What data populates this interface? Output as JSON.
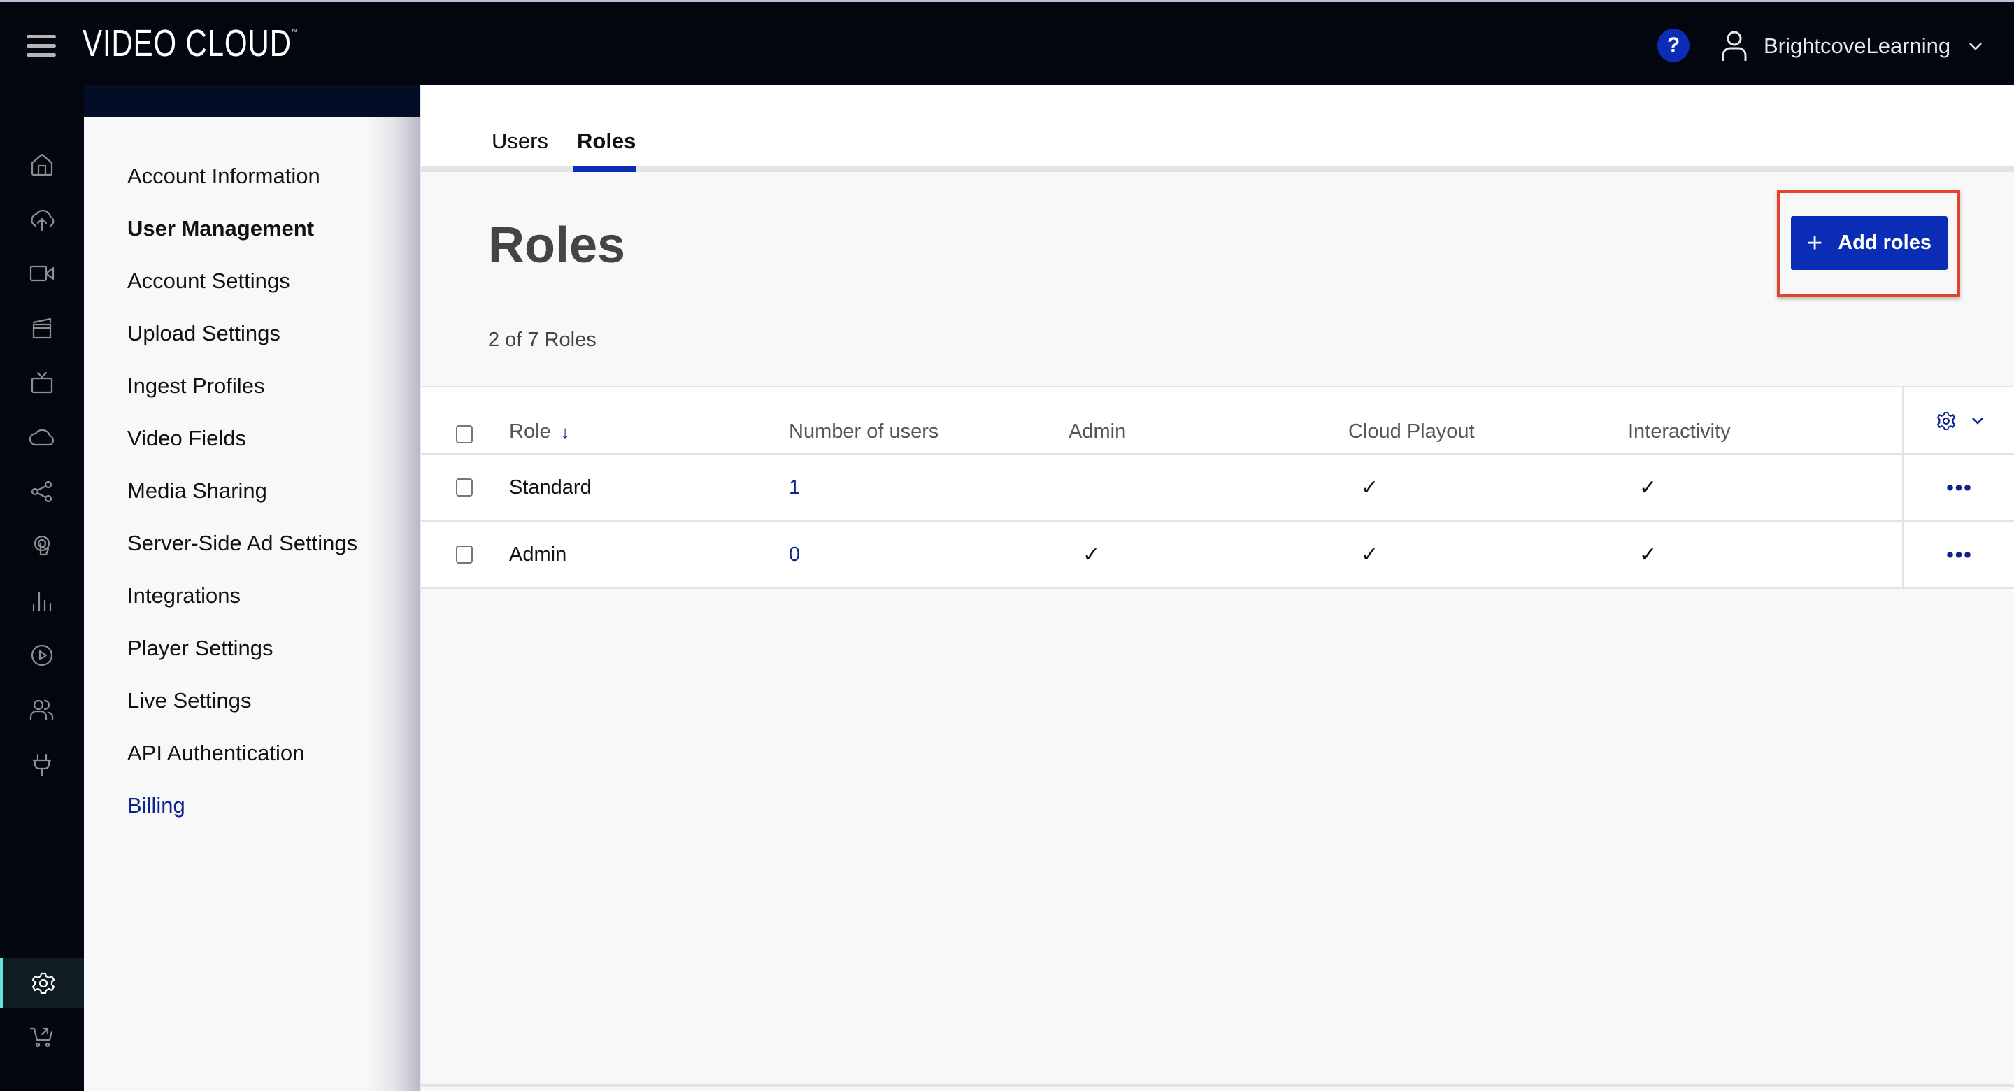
{
  "app": {
    "title": "VIDEO CLOUD",
    "trademark": "™",
    "help_label": "?",
    "account_name": "BrightcoveLearning"
  },
  "rail": {
    "items": [
      {
        "name": "home-icon"
      },
      {
        "name": "upload-icon"
      },
      {
        "name": "video-camera-icon"
      },
      {
        "name": "clapperboard-icon"
      },
      {
        "name": "tv-icon"
      },
      {
        "name": "cloud-icon"
      },
      {
        "name": "share-icon"
      },
      {
        "name": "interactivity-touch-icon"
      },
      {
        "name": "analytics-bars-icon"
      },
      {
        "name": "play-circle-icon"
      },
      {
        "name": "users-icon"
      },
      {
        "name": "plug-icon"
      }
    ],
    "bottom_items": [
      {
        "name": "settings-gear-icon",
        "active": true
      },
      {
        "name": "cart-icon"
      }
    ],
    "active_accent": "#6ee0dc"
  },
  "subnav": {
    "items": [
      {
        "label": "Account Information"
      },
      {
        "label": "User Management",
        "active": true
      },
      {
        "label": "Account Settings"
      },
      {
        "label": "Upload Settings"
      },
      {
        "label": "Ingest Profiles"
      },
      {
        "label": "Video Fields"
      },
      {
        "label": "Media Sharing"
      },
      {
        "label": "Server-Side Ad Settings"
      },
      {
        "label": "Integrations"
      },
      {
        "label": "Player Settings"
      },
      {
        "label": "Live Settings"
      },
      {
        "label": "API Authentication"
      },
      {
        "label": "Billing",
        "link": true
      }
    ]
  },
  "tabs": [
    {
      "label": "Users"
    },
    {
      "label": "Roles",
      "active": true
    }
  ],
  "page": {
    "title": "Roles",
    "count_text": "2 of 7 Roles",
    "add_button_label": "Add roles",
    "add_button_icon": "+"
  },
  "table": {
    "columns": [
      "Role",
      "Number of users",
      "Admin",
      "Cloud Playout",
      "Interactivity"
    ],
    "sort_icon": "↓",
    "rows": [
      {
        "role": "Standard",
        "users": "1",
        "admin": "",
        "cloud_playout": "✓",
        "interactivity": "✓",
        "actions": "•••"
      },
      {
        "role": "Admin",
        "users": "0",
        "admin": "✓",
        "cloud_playout": "✓",
        "interactivity": "✓",
        "actions": "•••"
      }
    ]
  },
  "colors": {
    "brand_blue": "#0b2db5",
    "link_blue": "#0d2490",
    "topbar_bg": "#03060f",
    "highlight_red": "#e0442c"
  }
}
